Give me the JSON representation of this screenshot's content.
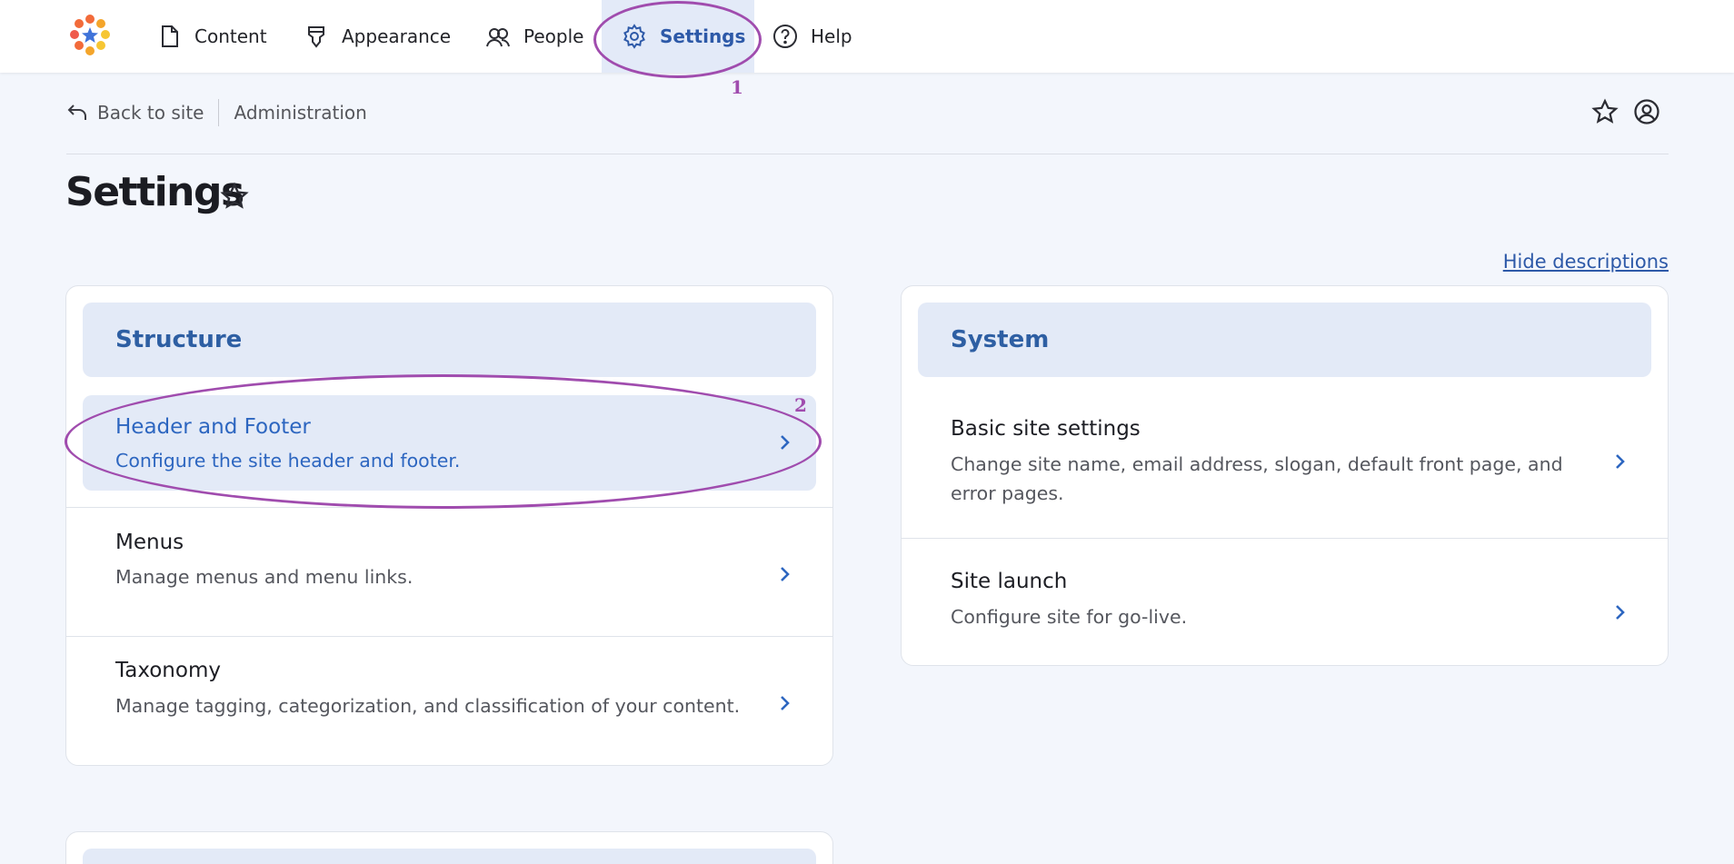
{
  "nav": {
    "content": "Content",
    "appearance": "Appearance",
    "people": "People",
    "settings": "Settings",
    "help": "Help"
  },
  "breadcrumb": {
    "back": "Back to site",
    "current": "Administration"
  },
  "page": {
    "title": "Settings",
    "hide_descriptions": "Hide descriptions"
  },
  "structure": {
    "heading": "Structure",
    "items": [
      {
        "title": "Header and Footer",
        "desc": "Configure the site header and footer."
      },
      {
        "title": "Menus",
        "desc": "Manage menus and menu links."
      },
      {
        "title": "Taxonomy",
        "desc": "Manage tagging, categorization, and classification of your content."
      }
    ]
  },
  "system": {
    "heading": "System",
    "items": [
      {
        "title": "Basic site settings",
        "desc": "Change site name, email address, slogan, default front page, and error pages."
      },
      {
        "title": "Site launch",
        "desc": "Configure site for go-live."
      }
    ]
  },
  "annotations": {
    "first": "1",
    "second": "2"
  },
  "colors": {
    "accent": "#2d59a8",
    "highlight_bg": "#e3eaf7",
    "annotation": "#a04cae"
  },
  "icons": [
    "logo-icon",
    "content-icon",
    "appearance-icon",
    "people-icon",
    "settings-icon",
    "help-icon",
    "back-arrow-icon",
    "star-icon",
    "user-icon",
    "chevron-right-icon"
  ]
}
